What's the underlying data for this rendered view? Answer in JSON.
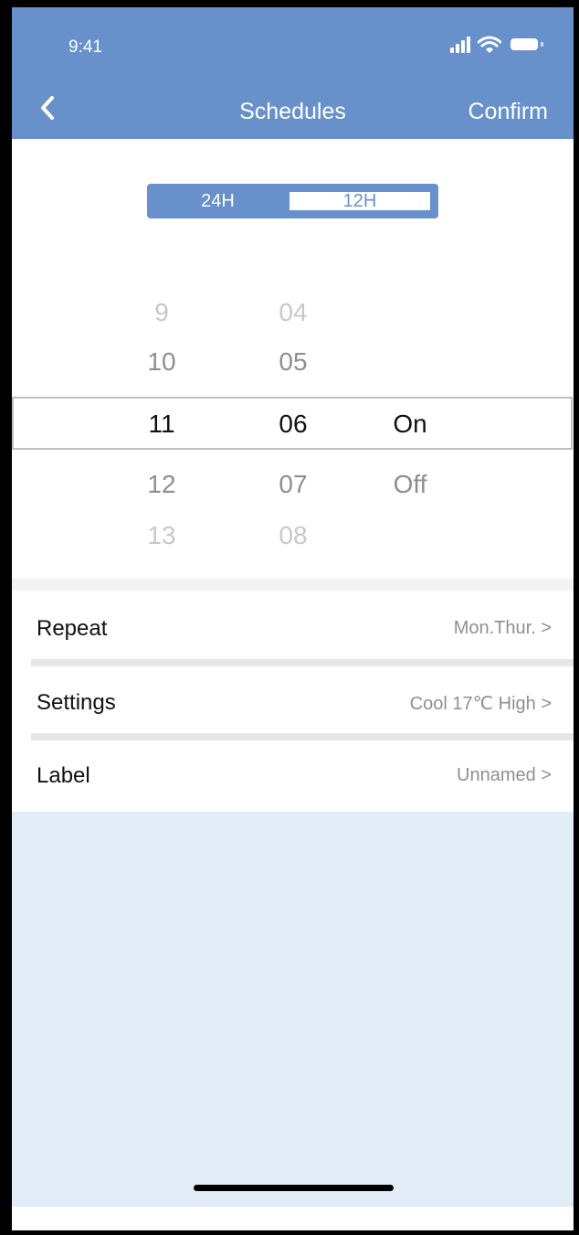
{
  "status_bar": {
    "time": "9:41"
  },
  "nav": {
    "back_icon": "chevron-left-icon",
    "title": "Schedules",
    "confirm_label": "Confirm"
  },
  "time_format": {
    "option_24h": "24H",
    "option_12h": "12H",
    "selected": "12H"
  },
  "picker": {
    "hours": [
      "9",
      "10",
      "11",
      "12",
      "13"
    ],
    "minutes": [
      "04",
      "05",
      "06",
      "07",
      "08"
    ],
    "modes": [
      "On",
      "Off"
    ],
    "selected": {
      "hour": "11",
      "minute": "06",
      "mode": "On"
    }
  },
  "settings": {
    "repeat": {
      "label": "Repeat",
      "value": "Mon.Thur.  >"
    },
    "settings": {
      "label": "Settings",
      "value": "Cool 17℃ High  >"
    },
    "label": {
      "label": "Label",
      "value": "Unnamed  >"
    }
  },
  "colors": {
    "header": "#6891cb",
    "panel": "#e2ecf6"
  }
}
